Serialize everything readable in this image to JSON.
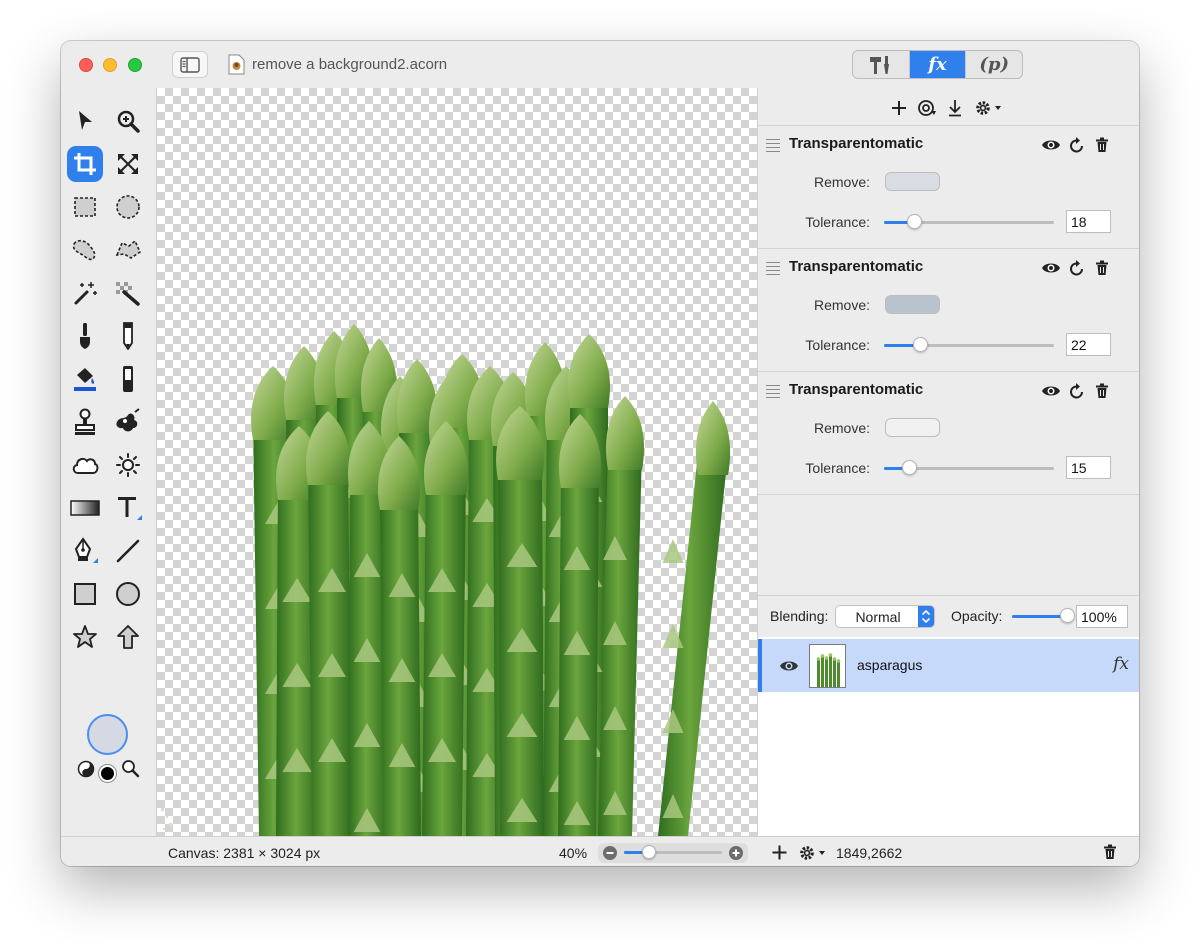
{
  "window": {
    "title": "remove a background2.acorn",
    "segments": [
      "",
      "fx",
      "(p)"
    ],
    "active_segment": "fx"
  },
  "tools": [
    "arrow-select-icon",
    "zoom-icon",
    "crop-icon",
    "transform-icon",
    "rect-select-icon",
    "ellipse-select-icon",
    "lasso-icon",
    "polygon-lasso-icon",
    "magic-wand-icon",
    "magic-eraser-icon",
    "brush-icon",
    "pencil-icon",
    "paint-bucket-icon",
    "eraser-icon",
    "clone-stamp-icon",
    "smudge-icon",
    "cloud-icon",
    "sun-icon",
    "gradient-icon",
    "text-icon",
    "bezier-pen-icon",
    "line-icon",
    "rectangle-shape-icon",
    "oval-shape-icon",
    "star-shape-icon",
    "arrow-shape-icon"
  ],
  "colors": {
    "accent": "#2f80ec",
    "fill_color": "#d5d9e3",
    "stroke_color": "#000000"
  },
  "filters": [
    {
      "name": "Transparentomatic",
      "remove_label": "Remove:",
      "tolerance_label": "Tolerance:",
      "swatch": "#d9dde3",
      "tolerance": "18",
      "tolerance_fraction": 0.18
    },
    {
      "name": "Transparentomatic",
      "remove_label": "Remove:",
      "tolerance_label": "Tolerance:",
      "swatch": "#b8c3cd",
      "tolerance": "22",
      "tolerance_fraction": 0.22
    },
    {
      "name": "Transparentomatic",
      "remove_label": "Remove:",
      "tolerance_label": "Tolerance:",
      "swatch": "#f1f1f1",
      "tolerance": "15",
      "tolerance_fraction": 0.15
    }
  ],
  "blending": {
    "label": "Blending:",
    "value": "Normal"
  },
  "opacity": {
    "label": "Opacity:",
    "value": "100%",
    "fraction": 1.0
  },
  "layers": [
    {
      "name": "asparagus",
      "fx": "fx",
      "visible": true
    }
  ],
  "status": {
    "canvas_size": "Canvas: 2381 × 3024 px",
    "zoom": "40%",
    "zoom_fraction": 0.25,
    "coords": "1849,2662"
  }
}
